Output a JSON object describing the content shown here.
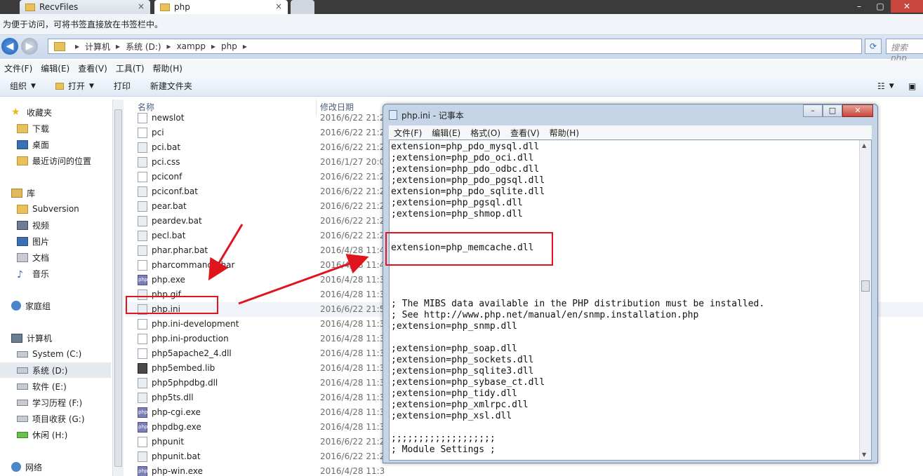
{
  "tabs": [
    {
      "label": "RecvFiles",
      "close": "×"
    },
    {
      "label": "php",
      "close": "×"
    }
  ],
  "bookmarks_bar_text": "为便于访问，可将书签直接放在书签栏中。",
  "breadcrumb": [
    "计算机",
    "系统 (D:)",
    "xampp",
    "php"
  ],
  "search_placeholder": "搜索 php",
  "menu": [
    "文件(F)",
    "编辑(E)",
    "查看(V)",
    "工具(T)",
    "帮助(H)"
  ],
  "toolbar": {
    "organize": "组织",
    "open": "打开",
    "print": "打印",
    "new_folder": "新建文件夹"
  },
  "nav": {
    "favorites": "收藏夹",
    "fav_items": [
      "下载",
      "桌面",
      "最近访问的位置"
    ],
    "library": "库",
    "lib_items": [
      "Subversion",
      "视频",
      "图片",
      "文档",
      "音乐"
    ],
    "homegroup": "家庭组",
    "computer": "计算机",
    "drives": [
      "System (C:)",
      "系统 (D:)",
      "软件 (E:)",
      "学习历程 (F:)",
      "项目收获 (G:)",
      "休闲 (H:)"
    ],
    "network": "网络"
  },
  "columns": {
    "name": "名称",
    "modified": "修改日期"
  },
  "files": [
    {
      "name": "newslot",
      "date": "2016/6/22 21:2",
      "type": "doc"
    },
    {
      "name": "pci",
      "date": "2016/6/22 21:2",
      "type": "doc"
    },
    {
      "name": "pci.bat",
      "date": "2016/6/22 21:2",
      "type": "bat"
    },
    {
      "name": "pci.css",
      "date": "2016/1/27 20:0",
      "type": "bat"
    },
    {
      "name": "pciconf",
      "date": "2016/6/22 21:2",
      "type": "doc"
    },
    {
      "name": "pciconf.bat",
      "date": "2016/6/22 21:2",
      "type": "bat"
    },
    {
      "name": "pear.bat",
      "date": "2016/6/22 21:2",
      "type": "bat"
    },
    {
      "name": "peardev.bat",
      "date": "2016/6/22 21:2",
      "type": "bat"
    },
    {
      "name": "pecl.bat",
      "date": "2016/6/22 21:2",
      "type": "bat"
    },
    {
      "name": "phar.phar.bat",
      "date": "2016/4/28 11:4",
      "type": "bat"
    },
    {
      "name": "pharcommand.phar",
      "date": "2016/4/28 11:4",
      "type": "doc"
    },
    {
      "name": "php.exe",
      "date": "2016/4/28 11:3",
      "type": "php"
    },
    {
      "name": "php.gif",
      "date": "2016/4/28 11:3",
      "type": "bat"
    },
    {
      "name": "php.ini",
      "date": "2016/6/22 21:5",
      "type": "bat"
    },
    {
      "name": "php.ini-development",
      "date": "2016/4/28 11:3",
      "type": "doc"
    },
    {
      "name": "php.ini-production",
      "date": "2016/4/28 11:3",
      "type": "doc"
    },
    {
      "name": "php5apache2_4.dll",
      "date": "2016/4/28 11:3",
      "type": "doc"
    },
    {
      "name": "php5embed.lib",
      "date": "2016/4/28 11:3",
      "type": "lib"
    },
    {
      "name": "php5phpdbg.dll",
      "date": "2016/4/28 11:3",
      "type": "bat"
    },
    {
      "name": "php5ts.dll",
      "date": "2016/4/28 11:3",
      "type": "bat"
    },
    {
      "name": "php-cgi.exe",
      "date": "2016/4/28 11:3",
      "type": "php"
    },
    {
      "name": "phpdbg.exe",
      "date": "2016/4/28 11:3",
      "type": "php"
    },
    {
      "name": "phpunit",
      "date": "2016/6/22 21:2",
      "type": "doc"
    },
    {
      "name": "phpunit.bat",
      "date": "2016/6/22 21:2",
      "type": "bat"
    },
    {
      "name": "php-win.exe",
      "date": "2016/4/28 11:3",
      "type": "php"
    }
  ],
  "notepad": {
    "title": "php.ini - 记事本",
    "menu": [
      "文件(F)",
      "编辑(E)",
      "格式(O)",
      "查看(V)",
      "帮助(H)"
    ],
    "lines": [
      "extension=php_pdo_mysql.dll",
      ";extension=php_pdo_oci.dll",
      ";extension=php_pdo_odbc.dll",
      ";extension=php_pdo_pgsql.dll",
      "extension=php_pdo_sqlite.dll",
      ";extension=php_pgsql.dll",
      ";extension=php_shmop.dll",
      "",
      "",
      "extension=php_memcache.dll",
      "",
      "",
      "",
      "",
      "; The MIBS data available in the PHP distribution must be installed.",
      "; See http://www.php.net/manual/en/snmp.installation.php",
      ";extension=php_snmp.dll",
      "",
      ";extension=php_soap.dll",
      ";extension=php_sockets.dll",
      ";extension=php_sqlite3.dll",
      ";extension=php_sybase_ct.dll",
      ";extension=php_tidy.dll",
      ";extension=php_xmlrpc.dll",
      ";extension=php_xsl.dll",
      "",
      ";;;;;;;;;;;;;;;;;;;",
      "; Module Settings ;"
    ]
  },
  "colors": {
    "annotation": "#e0141c",
    "selection": "#e5eaf0"
  }
}
